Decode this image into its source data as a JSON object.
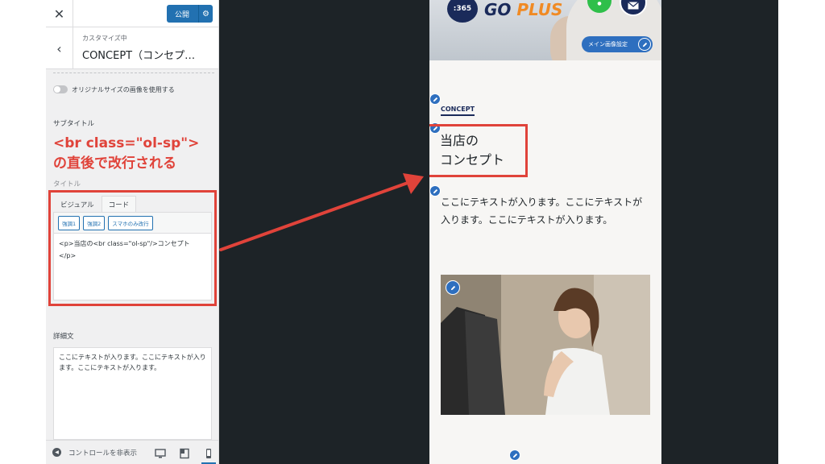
{
  "panel": {
    "close_icon": "close-icon",
    "publish_label": "公開",
    "customizing_label": "カスタマイズ中",
    "section_title": "CONCEPT（コンセプ…",
    "original_size_label": "オリジナルサイズの画像を使用する",
    "subtitle_label": "サブタイトル",
    "annotation_line1": "<br class=\"ol-sp\">",
    "annotation_line2": "の直後で改行される",
    "title_label_partial": "タイトル",
    "editor": {
      "tab_visual": "ビジュアル",
      "tab_code": "コード",
      "buttons": [
        "強調1",
        "強調2",
        "スマホのみ改行"
      ],
      "code_line1": "<p>当店の<br class=\"ol-sp\"/>コンセプト",
      "code_line2": "</p>"
    },
    "detail_label": "詳細文",
    "detail_text": "ここにテキストが入ります。ここにテキストが入ります。ここにテキストが入ります。",
    "footer": {
      "hide_controls_label": "コントロールを非表示",
      "devices": [
        "desktop-icon",
        "tablet-icon",
        "mobile-icon"
      ]
    }
  },
  "preview": {
    "logo_badge": ":365",
    "logo_go": "GO ",
    "logo_plus": "PLUS",
    "main_image_label": "メイン画像設定",
    "concept_label": "CONCEPT",
    "heading": "当店の\nコンセプト",
    "body": "ここにテキストが入ります。ここにテキストが入ります。ここにテキストが入ります。"
  },
  "colors": {
    "accent_red": "#e0433a",
    "wp_blue": "#2271b1",
    "brand_navy": "#1a2a5a",
    "brand_orange": "#f08a24",
    "preview_dark": "#1d2327"
  }
}
